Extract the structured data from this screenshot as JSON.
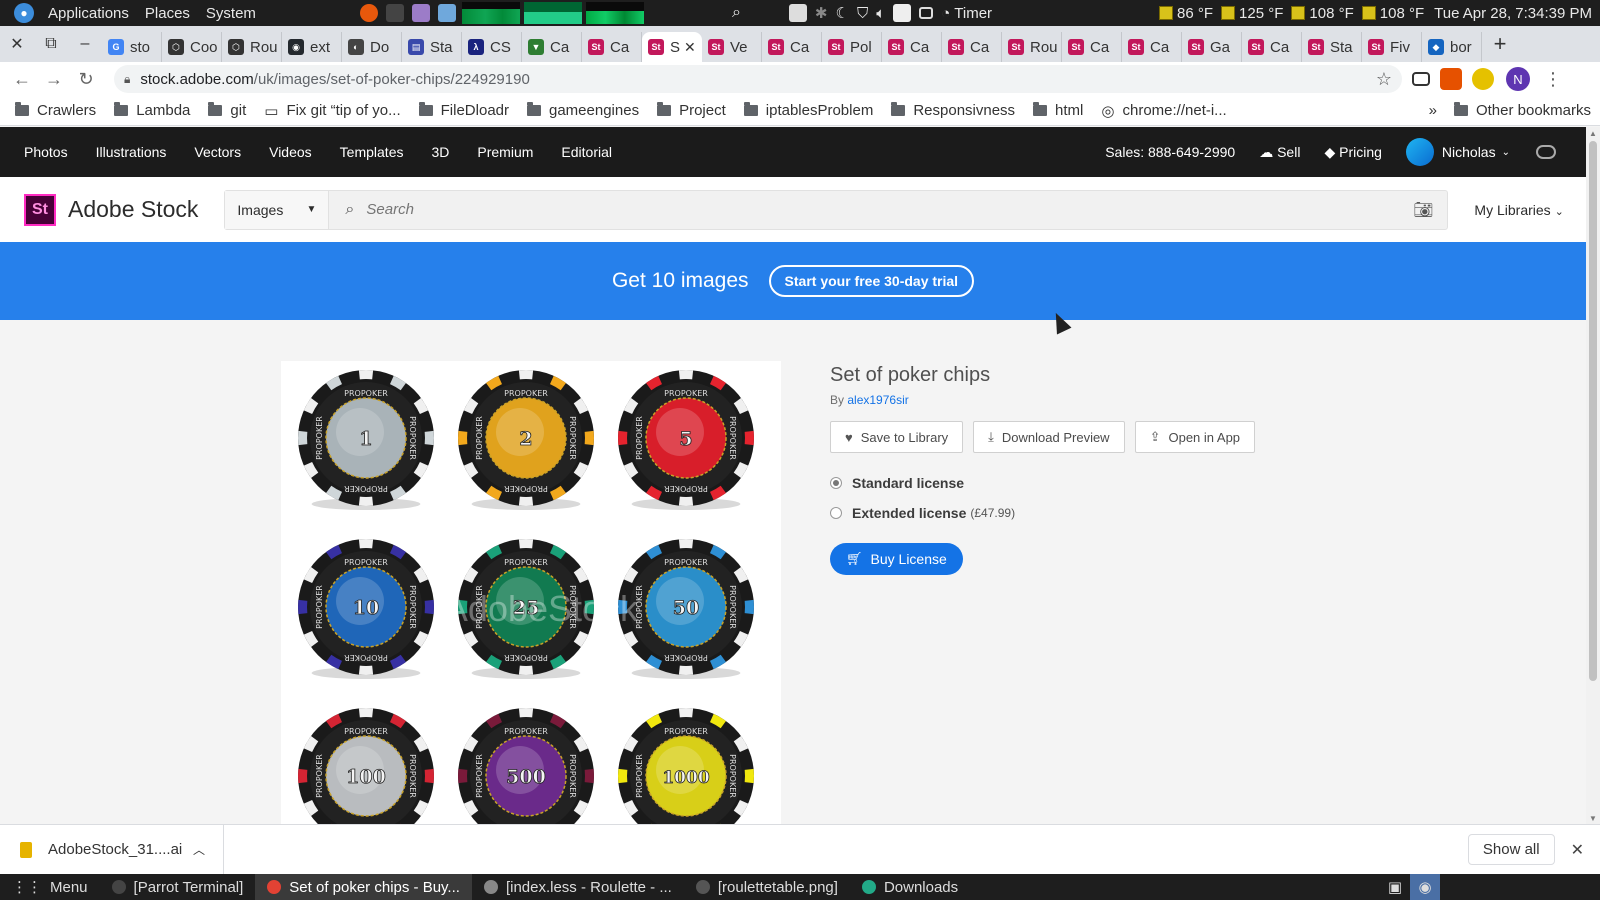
{
  "system_panel": {
    "menus": [
      "Applications",
      "Places",
      "System"
    ],
    "timer_label": "Timer",
    "temps": [
      "86 °F",
      "125 °F",
      "108 °F",
      "108 °F"
    ],
    "datetime": "Tue Apr 28, 7:34:39 PM"
  },
  "tabs": [
    {
      "title": "sto",
      "color": "#4285f4",
      "glyph": "G"
    },
    {
      "title": "Coo",
      "color": "#333333",
      "glyph": "⬡"
    },
    {
      "title": "Rou",
      "color": "#333333",
      "glyph": "⬡"
    },
    {
      "title": "ext",
      "color": "#24292e",
      "glyph": "◉"
    },
    {
      "title": "Do",
      "color": "#444444",
      "glyph": "◐"
    },
    {
      "title": "Sta",
      "color": "#3949ab",
      "glyph": "▤"
    },
    {
      "title": "CS",
      "color": "#1a237e",
      "glyph": "λ"
    },
    {
      "title": "Ca",
      "color": "#2e7d32",
      "glyph": "▼"
    },
    {
      "title": "Ca",
      "color": "#c2185b",
      "glyph": "St"
    },
    {
      "title": "S",
      "color": "#c2185b",
      "glyph": "St"
    },
    {
      "title": "Ve",
      "color": "#c2185b",
      "glyph": "St"
    },
    {
      "title": "Ca",
      "color": "#c2185b",
      "glyph": "St"
    },
    {
      "title": "Pol",
      "color": "#c2185b",
      "glyph": "St"
    },
    {
      "title": "Ca",
      "color": "#c2185b",
      "glyph": "St"
    },
    {
      "title": "Ca",
      "color": "#c2185b",
      "glyph": "St"
    },
    {
      "title": "Rou",
      "color": "#c2185b",
      "glyph": "St"
    },
    {
      "title": "Ca",
      "color": "#c2185b",
      "glyph": "St"
    },
    {
      "title": "Ca",
      "color": "#c2185b",
      "glyph": "St"
    },
    {
      "title": "Ga",
      "color": "#c2185b",
      "glyph": "St"
    },
    {
      "title": "Ca",
      "color": "#c2185b",
      "glyph": "St"
    },
    {
      "title": "Sta",
      "color": "#c2185b",
      "glyph": "St"
    },
    {
      "title": "Fiv",
      "color": "#c2185b",
      "glyph": "St"
    },
    {
      "title": "bor",
      "color": "#1565c0",
      "glyph": "◆"
    }
  ],
  "active_tab_index": 9,
  "address": {
    "host": "stock.adobe.com",
    "path": "/uk/images/set-of-poker-chips/224929190"
  },
  "bookmarks": [
    "Crawlers",
    "Lambda",
    "git",
    "Fix git “tip of yo...",
    "FileDloadr",
    "gameengines",
    "Project",
    "iptablesProblem",
    "Responsivness",
    "html",
    "chrome://net-i..."
  ],
  "bookmarks_more": "»",
  "other_bookmarks": "Other bookmarks",
  "adobe_nav": {
    "items": [
      "Photos",
      "Illustrations",
      "Vectors",
      "Videos",
      "Templates",
      "3D",
      "Premium",
      "Editorial"
    ],
    "sales": "Sales: 888-649-2990",
    "sell": "Sell",
    "pricing": "Pricing",
    "user": "Nicholas"
  },
  "header": {
    "brand": "Adobe Stock",
    "logo_text": "St",
    "scope": "Images",
    "search_placeholder": "Search",
    "my_libraries": "My Libraries"
  },
  "promo": {
    "text": "Get 10 images",
    "button": "Start your free 30-day trial"
  },
  "asset": {
    "title": "Set of poker chips",
    "by_prefix": "By",
    "author": "alex1976sir",
    "actions": [
      "Save to Library",
      "Download Preview",
      "Open in App"
    ],
    "licenses": [
      {
        "label": "Standard license",
        "price": "",
        "selected": true
      },
      {
        "label": "Extended license",
        "price": "(£47.99)",
        "selected": false
      }
    ],
    "buy_label": "Buy License"
  },
  "chips": {
    "brand_text": "PROPOKER",
    "watermark": "AdobeStock",
    "items": [
      {
        "value": "1",
        "color": "#a9b3b8",
        "stripe": "#cfd6d9"
      },
      {
        "value": "2",
        "color": "#e0a21d",
        "stripe": "#f2a81c"
      },
      {
        "value": "5",
        "color": "#d81e2a",
        "stripe": "#e5232e"
      },
      {
        "value": "10",
        "color": "#1f66b8",
        "stripe": "#3730a3"
      },
      {
        "value": "25",
        "color": "#117a50",
        "stripe": "#1aa179"
      },
      {
        "value": "50",
        "color": "#2a8ec9",
        "stripe": "#2e8fd4"
      },
      {
        "value": "100",
        "color": "#b9bcbf",
        "stripe": "#d42433"
      },
      {
        "value": "500",
        "color": "#6a2a8a",
        "stripe": "#7a1a3a"
      },
      {
        "value": "1000",
        "color": "#d8cf18",
        "stripe": "#f1e80e"
      }
    ]
  },
  "downloads": {
    "file": "AdobeStock_31....ai",
    "show_all": "Show all"
  },
  "taskbar": {
    "menu": "Menu",
    "items": [
      "[Parrot Terminal]",
      "Set of poker chips - Buy...",
      "[index.less - Roulette - ...",
      "[roulettetable.png]",
      "Downloads"
    ],
    "active_index": 1
  }
}
